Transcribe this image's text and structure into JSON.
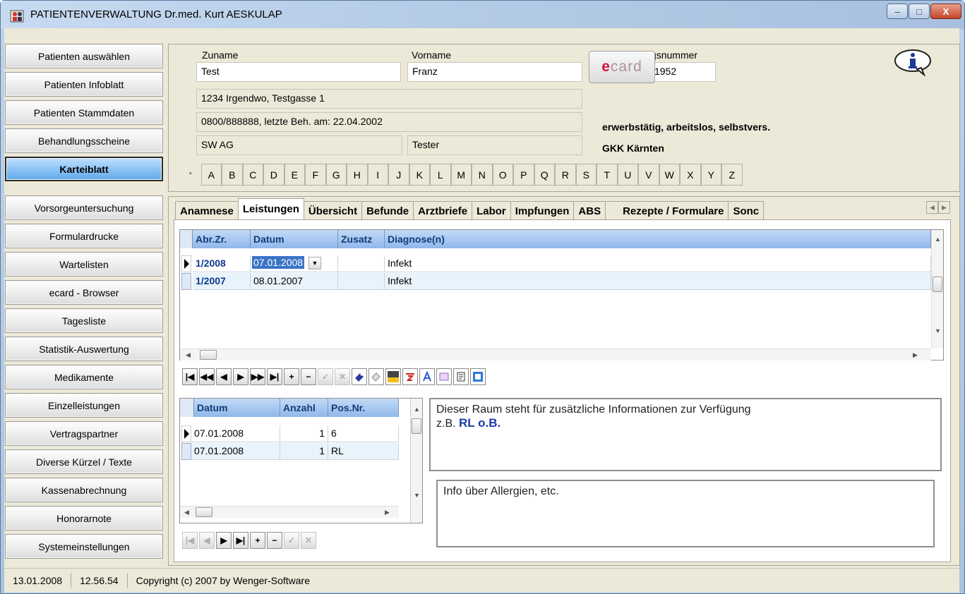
{
  "window": {
    "title": "PATIENTENVERWALTUNG  Dr.med. Kurt AESKULAP",
    "minimize": "–",
    "maximize": "□",
    "close": "X"
  },
  "sidebar": {
    "items": [
      {
        "label": "Patienten auswählen"
      },
      {
        "label": "Patienten Infoblatt"
      },
      {
        "label": "Patienten Stammdaten"
      },
      {
        "label": "Behandlungsscheine"
      },
      {
        "label": "Karteiblatt",
        "active": true
      },
      {
        "label": "Vorsorgeuntersuchung"
      },
      {
        "label": "Formulardrucke"
      },
      {
        "label": "Wartelisten"
      },
      {
        "label": "ecard - Browser"
      },
      {
        "label": "Tagesliste"
      },
      {
        "label": "Statistik-Auswertung"
      },
      {
        "label": "Medikamente"
      },
      {
        "label": "Einzelleistungen"
      },
      {
        "label": "Vertragspartner"
      },
      {
        "label": "Diverse Kürzel / Texte"
      },
      {
        "label": "Kassenabrechnung"
      },
      {
        "label": "Honorarnote"
      },
      {
        "label": "Systemeinstellungen"
      }
    ]
  },
  "patient": {
    "surname_label": "Zuname",
    "surname": "Test",
    "firstname_label": "Vorname",
    "firstname": "Franz",
    "insurance_label": "Versicherungsnummer",
    "insurance": "1938 19.04.1952",
    "address": "1234  Irgendwo,  Testgasse 1",
    "phone_line": "0800/888888,  letzte Beh. am: 22.04.2002",
    "employer": "SW AG",
    "profession": "Tester",
    "status_line": "erwerbstätig, arbeitslos, selbstvers.",
    "insurer": "GKK Kärnten"
  },
  "ecard": {
    "prefix": "e",
    "rest": "card"
  },
  "alphabet": [
    "*",
    "A",
    "B",
    "C",
    "D",
    "E",
    "F",
    "G",
    "H",
    "I",
    "J",
    "K",
    "L",
    "M",
    "N",
    "O",
    "P",
    "Q",
    "R",
    "S",
    "T",
    "U",
    "V",
    "W",
    "X",
    "Y",
    "Z"
  ],
  "tabs": [
    {
      "label": "Anamnese"
    },
    {
      "label": "Leistungen",
      "active": true
    },
    {
      "label": "Übersicht"
    },
    {
      "label": "Befunde"
    },
    {
      "label": "Arztbriefe"
    },
    {
      "label": "Labor"
    },
    {
      "label": "Impfungen"
    },
    {
      "label": "ABS"
    },
    {
      "label": "Rezepte / Formulare"
    },
    {
      "label": "Sonc"
    }
  ],
  "upper_grid": {
    "headers": {
      "period": "Abr.Zr.",
      "date": "Datum",
      "extra": "Zusatz",
      "diagnosis": "Diagnose(n)"
    },
    "rows": [
      {
        "period": "1/2008",
        "date": "07.01.2008",
        "extra": "",
        "diagnosis": "Infekt"
      },
      {
        "period": "1/2007",
        "date": "08.01.2007",
        "extra": "",
        "diagnosis": "Infekt"
      }
    ]
  },
  "lower_grid": {
    "headers": {
      "date": "Datum",
      "count": "Anzahl",
      "pos": "Pos.Nr."
    },
    "rows": [
      {
        "date": "07.01.2008",
        "count": "1",
        "pos": "6"
      },
      {
        "date": "07.01.2008",
        "count": "1",
        "pos": "RL"
      }
    ]
  },
  "info": {
    "text": "Dieser Raum steht für zusätzliche Informationen zur Verfügung",
    "prefix": "z.B.",
    "codes": "RL  o.B.",
    "allergy": "Info über Allergien, etc."
  },
  "status": {
    "date": "13.01.2008",
    "time": "12.56.54",
    "copyright": "Copyright (c) 2007 by Wenger-Software"
  }
}
